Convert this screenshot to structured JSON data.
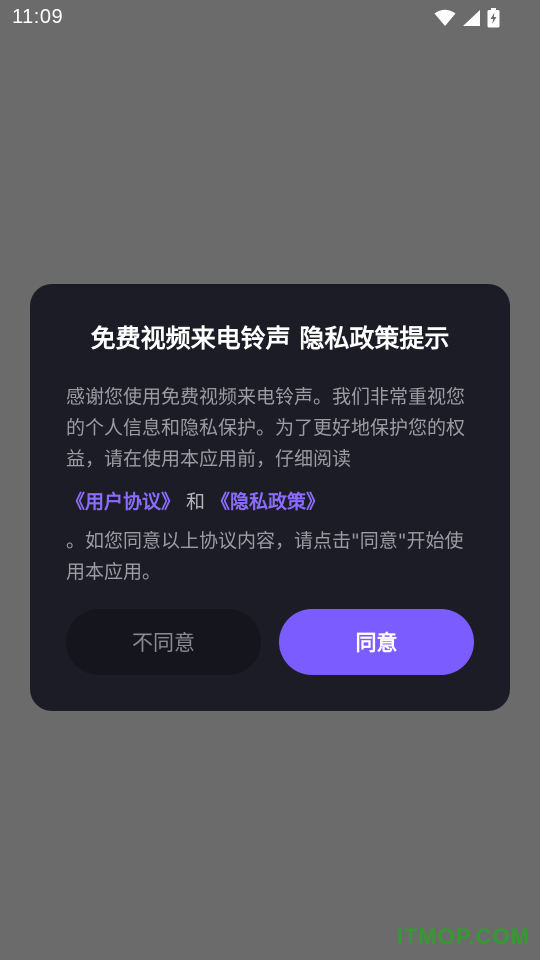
{
  "status_bar": {
    "time": "11:09",
    "icons": [
      "wifi-icon",
      "signal-icon",
      "battery-charging-icon"
    ]
  },
  "dialog": {
    "title": "免费视频来电铃声 隐私政策提示",
    "intro_text": "感谢您使用免费视频来电铃声。我们非常重视您的个人信息和隐私保护。为了更好地保护您的权益，请在使用本应用前，仔细阅读",
    "user_agreement_link": "《用户协议》",
    "link_separator": "和",
    "privacy_policy_link": "《隐私政策》",
    "outro_text": "。如您同意以上协议内容，请点击\"同意\"开始使用本应用。",
    "disagree_label": "不同意",
    "agree_label": "同意"
  },
  "watermark": "ITMOP.COM",
  "colors": {
    "backdrop": "#6b6b6b",
    "dialog_bg": "#1c1c26",
    "accent": "#7b5cff",
    "link": "#8b6cff",
    "body_text": "#9b9ca4",
    "watermark": "#2fa02a"
  }
}
